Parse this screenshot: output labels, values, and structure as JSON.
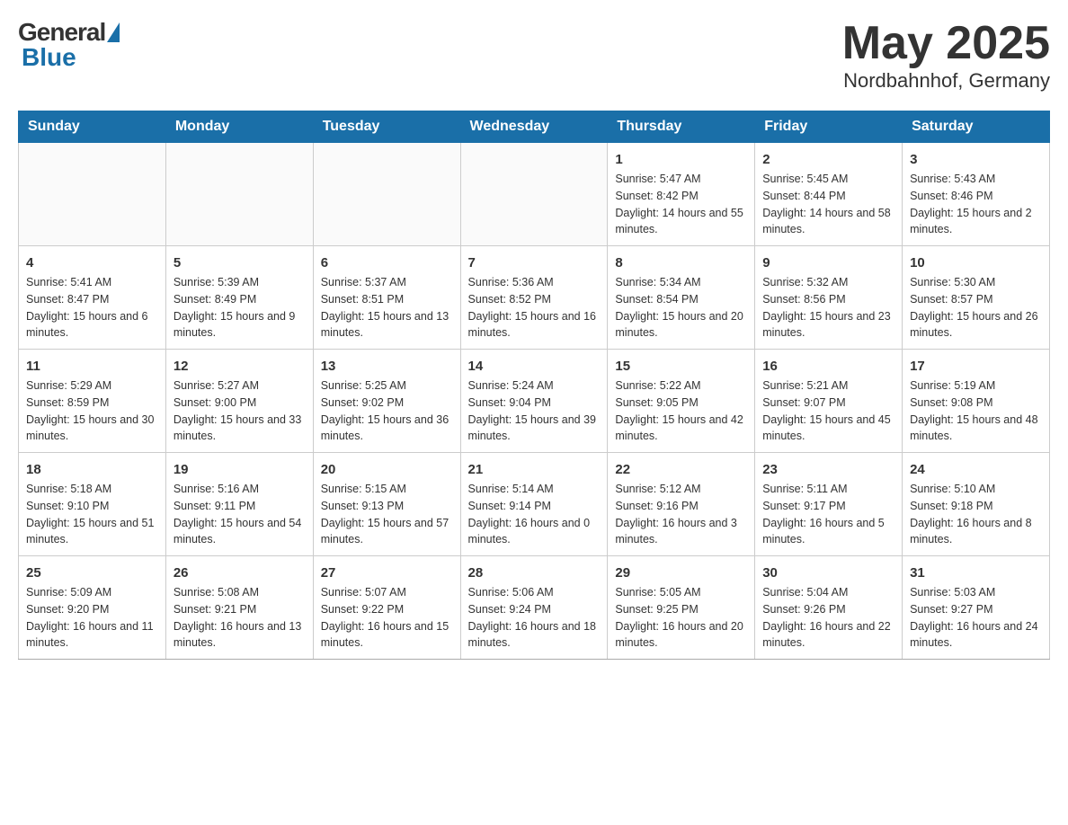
{
  "header": {
    "logo_general": "General",
    "logo_blue": "Blue",
    "month_title": "May 2025",
    "location": "Nordbahnhof, Germany"
  },
  "calendar": {
    "days_of_week": [
      "Sunday",
      "Monday",
      "Tuesday",
      "Wednesday",
      "Thursday",
      "Friday",
      "Saturday"
    ],
    "weeks": [
      [
        {
          "day": "",
          "info": ""
        },
        {
          "day": "",
          "info": ""
        },
        {
          "day": "",
          "info": ""
        },
        {
          "day": "",
          "info": ""
        },
        {
          "day": "1",
          "info": "Sunrise: 5:47 AM\nSunset: 8:42 PM\nDaylight: 14 hours and 55 minutes."
        },
        {
          "day": "2",
          "info": "Sunrise: 5:45 AM\nSunset: 8:44 PM\nDaylight: 14 hours and 58 minutes."
        },
        {
          "day": "3",
          "info": "Sunrise: 5:43 AM\nSunset: 8:46 PM\nDaylight: 15 hours and 2 minutes."
        }
      ],
      [
        {
          "day": "4",
          "info": "Sunrise: 5:41 AM\nSunset: 8:47 PM\nDaylight: 15 hours and 6 minutes."
        },
        {
          "day": "5",
          "info": "Sunrise: 5:39 AM\nSunset: 8:49 PM\nDaylight: 15 hours and 9 minutes."
        },
        {
          "day": "6",
          "info": "Sunrise: 5:37 AM\nSunset: 8:51 PM\nDaylight: 15 hours and 13 minutes."
        },
        {
          "day": "7",
          "info": "Sunrise: 5:36 AM\nSunset: 8:52 PM\nDaylight: 15 hours and 16 minutes."
        },
        {
          "day": "8",
          "info": "Sunrise: 5:34 AM\nSunset: 8:54 PM\nDaylight: 15 hours and 20 minutes."
        },
        {
          "day": "9",
          "info": "Sunrise: 5:32 AM\nSunset: 8:56 PM\nDaylight: 15 hours and 23 minutes."
        },
        {
          "day": "10",
          "info": "Sunrise: 5:30 AM\nSunset: 8:57 PM\nDaylight: 15 hours and 26 minutes."
        }
      ],
      [
        {
          "day": "11",
          "info": "Sunrise: 5:29 AM\nSunset: 8:59 PM\nDaylight: 15 hours and 30 minutes."
        },
        {
          "day": "12",
          "info": "Sunrise: 5:27 AM\nSunset: 9:00 PM\nDaylight: 15 hours and 33 minutes."
        },
        {
          "day": "13",
          "info": "Sunrise: 5:25 AM\nSunset: 9:02 PM\nDaylight: 15 hours and 36 minutes."
        },
        {
          "day": "14",
          "info": "Sunrise: 5:24 AM\nSunset: 9:04 PM\nDaylight: 15 hours and 39 minutes."
        },
        {
          "day": "15",
          "info": "Sunrise: 5:22 AM\nSunset: 9:05 PM\nDaylight: 15 hours and 42 minutes."
        },
        {
          "day": "16",
          "info": "Sunrise: 5:21 AM\nSunset: 9:07 PM\nDaylight: 15 hours and 45 minutes."
        },
        {
          "day": "17",
          "info": "Sunrise: 5:19 AM\nSunset: 9:08 PM\nDaylight: 15 hours and 48 minutes."
        }
      ],
      [
        {
          "day": "18",
          "info": "Sunrise: 5:18 AM\nSunset: 9:10 PM\nDaylight: 15 hours and 51 minutes."
        },
        {
          "day": "19",
          "info": "Sunrise: 5:16 AM\nSunset: 9:11 PM\nDaylight: 15 hours and 54 minutes."
        },
        {
          "day": "20",
          "info": "Sunrise: 5:15 AM\nSunset: 9:13 PM\nDaylight: 15 hours and 57 minutes."
        },
        {
          "day": "21",
          "info": "Sunrise: 5:14 AM\nSunset: 9:14 PM\nDaylight: 16 hours and 0 minutes."
        },
        {
          "day": "22",
          "info": "Sunrise: 5:12 AM\nSunset: 9:16 PM\nDaylight: 16 hours and 3 minutes."
        },
        {
          "day": "23",
          "info": "Sunrise: 5:11 AM\nSunset: 9:17 PM\nDaylight: 16 hours and 5 minutes."
        },
        {
          "day": "24",
          "info": "Sunrise: 5:10 AM\nSunset: 9:18 PM\nDaylight: 16 hours and 8 minutes."
        }
      ],
      [
        {
          "day": "25",
          "info": "Sunrise: 5:09 AM\nSunset: 9:20 PM\nDaylight: 16 hours and 11 minutes."
        },
        {
          "day": "26",
          "info": "Sunrise: 5:08 AM\nSunset: 9:21 PM\nDaylight: 16 hours and 13 minutes."
        },
        {
          "day": "27",
          "info": "Sunrise: 5:07 AM\nSunset: 9:22 PM\nDaylight: 16 hours and 15 minutes."
        },
        {
          "day": "28",
          "info": "Sunrise: 5:06 AM\nSunset: 9:24 PM\nDaylight: 16 hours and 18 minutes."
        },
        {
          "day": "29",
          "info": "Sunrise: 5:05 AM\nSunset: 9:25 PM\nDaylight: 16 hours and 20 minutes."
        },
        {
          "day": "30",
          "info": "Sunrise: 5:04 AM\nSunset: 9:26 PM\nDaylight: 16 hours and 22 minutes."
        },
        {
          "day": "31",
          "info": "Sunrise: 5:03 AM\nSunset: 9:27 PM\nDaylight: 16 hours and 24 minutes."
        }
      ]
    ]
  }
}
